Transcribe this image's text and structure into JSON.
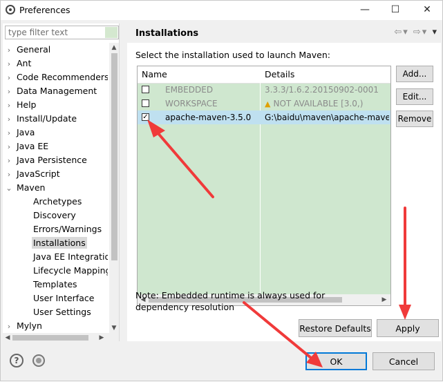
{
  "window": {
    "title": "Preferences",
    "controls": {
      "minimize": "—",
      "maximize": "☐",
      "close": "✕"
    }
  },
  "sidebar": {
    "filter_placeholder": "type filter text",
    "items": [
      {
        "label": "General",
        "expander": "›"
      },
      {
        "label": "Ant",
        "expander": "›"
      },
      {
        "label": "Code Recommenders",
        "expander": "›"
      },
      {
        "label": "Data Management",
        "expander": "›"
      },
      {
        "label": "Help",
        "expander": "›"
      },
      {
        "label": "Install/Update",
        "expander": "›"
      },
      {
        "label": "Java",
        "expander": "›"
      },
      {
        "label": "Java EE",
        "expander": "›"
      },
      {
        "label": "Java Persistence",
        "expander": "›"
      },
      {
        "label": "JavaScript",
        "expander": "›"
      },
      {
        "label": "Maven",
        "expander": "⌄"
      },
      {
        "label": "Archetypes"
      },
      {
        "label": "Discovery"
      },
      {
        "label": "Errors/Warnings"
      },
      {
        "label": "Installations",
        "selected": true
      },
      {
        "label": "Java EE Integration"
      },
      {
        "label": "Lifecycle Mapping"
      },
      {
        "label": "Templates"
      },
      {
        "label": "User Interface"
      },
      {
        "label": "User Settings"
      },
      {
        "label": "Mylyn",
        "expander": "›"
      }
    ]
  },
  "main": {
    "title": "Installations",
    "nav_icons": {
      "back": "⇦",
      "back_menu": "▾",
      "forward": "⇨",
      "forward_menu": "▾",
      "view_menu": "▾"
    },
    "instructions": "Select the installation used to launch Maven:",
    "table": {
      "columns": [
        "Name",
        "Details"
      ],
      "rows": [
        {
          "checked": false,
          "name": "EMBEDDED",
          "details": "3.3.3/1.6.2.20150902-0001",
          "disabled": true,
          "warning": false
        },
        {
          "checked": false,
          "name": "WORKSPACE",
          "details": "NOT AVAILABLE [3.0,)",
          "disabled": true,
          "warning": true
        },
        {
          "checked": true,
          "name": "apache-maven-3.5.0",
          "details": "G:\\baidu\\maven\\apache-maven",
          "disabled": false,
          "warning": false
        }
      ]
    },
    "buttons": {
      "add": "Add...",
      "edit": "Edit...",
      "remove": "Remove"
    },
    "note": "Note: Embedded runtime is always used for dependency resolution",
    "restore_defaults": "Restore Defaults",
    "apply": "Apply"
  },
  "footer": {
    "ok": "OK",
    "cancel": "Cancel",
    "help_glyph": "?"
  },
  "colors": {
    "table_background": "#cfe7cf",
    "annotation_red": "#f03a3a",
    "default_button_border": "#0078d7"
  }
}
